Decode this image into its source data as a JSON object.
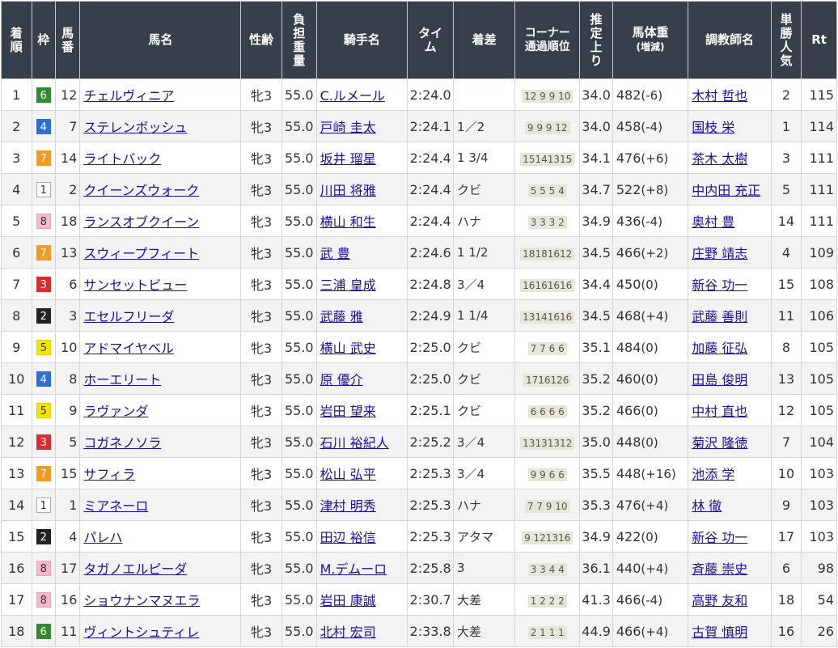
{
  "headers": {
    "rank": "着順",
    "waku": "枠",
    "umaban": "馬番",
    "name": "馬名",
    "sexage": "性齢",
    "weight": "負担重量",
    "jockey": "騎手名",
    "time": "タイム",
    "margin": "着差",
    "corner": "コーナー通過順位",
    "agari": "推定上り",
    "bodyweight": "馬体重",
    "bodyweight_sub": "(増減)",
    "trainer": "調教師名",
    "popularity": "単勝人気",
    "rt": "Rt"
  },
  "rows": [
    {
      "rank": "1",
      "waku": "6",
      "umaban": "12",
      "name": "チェルヴィニア",
      "sexage": "牝3",
      "weight": "55.0",
      "jockey": "C.ルメール",
      "time": "2:24.0",
      "margin": "",
      "corner": "12 9 9 10",
      "agari": "34.0",
      "bw": "482",
      "bwdiff": "(-6)",
      "trainer": "木村 哲也",
      "pop": "2",
      "rt": "115"
    },
    {
      "rank": "2",
      "waku": "4",
      "umaban": "7",
      "name": "ステレンボッシュ",
      "sexage": "牝3",
      "weight": "55.0",
      "jockey": "戸崎 圭太",
      "time": "2:24.1",
      "margin": "1／2",
      "corner": "9 9 9 12",
      "agari": "34.0",
      "bw": "458",
      "bwdiff": "(-4)",
      "trainer": "国枝 栄",
      "pop": "1",
      "rt": "114"
    },
    {
      "rank": "3",
      "waku": "7",
      "umaban": "14",
      "name": "ライトバック",
      "sexage": "牝3",
      "weight": "55.0",
      "jockey": "坂井 瑠星",
      "time": "2:24.4",
      "margin": "1 3/4",
      "corner": "15141315",
      "agari": "34.1",
      "bw": "476",
      "bwdiff": "(+6)",
      "trainer": "茶木 太樹",
      "pop": "3",
      "rt": "111"
    },
    {
      "rank": "4",
      "waku": "1",
      "umaban": "2",
      "name": "クイーンズウォーク",
      "sexage": "牝3",
      "weight": "55.0",
      "jockey": "川田 将雅",
      "time": "2:24.4",
      "margin": "クビ",
      "corner": "5 5 5 4",
      "agari": "34.7",
      "bw": "522",
      "bwdiff": "(+8)",
      "trainer": "中内田 充正",
      "pop": "5",
      "rt": "111"
    },
    {
      "rank": "5",
      "waku": "8",
      "umaban": "18",
      "name": "ランスオブクイーン",
      "sexage": "牝3",
      "weight": "55.0",
      "jockey": "横山 和生",
      "time": "2:24.4",
      "margin": "ハナ",
      "corner": "3 3 3 2",
      "agari": "34.9",
      "bw": "436",
      "bwdiff": "(-4)",
      "trainer": "奥村 豊",
      "pop": "14",
      "rt": "111"
    },
    {
      "rank": "6",
      "waku": "7",
      "umaban": "13",
      "name": "スウィープフィート",
      "sexage": "牝3",
      "weight": "55.0",
      "jockey": "武 豊",
      "time": "2:24.6",
      "margin": "1 1/2",
      "corner": "18181612",
      "agari": "34.5",
      "bw": "466",
      "bwdiff": "(+2)",
      "trainer": "庄野 靖志",
      "pop": "4",
      "rt": "109"
    },
    {
      "rank": "7",
      "waku": "3",
      "umaban": "6",
      "name": "サンセットビュー",
      "sexage": "牝3",
      "weight": "55.0",
      "jockey": "三浦 皇成",
      "time": "2:24.8",
      "margin": "3／4",
      "corner": "16161616",
      "agari": "34.4",
      "bw": "450",
      "bwdiff": "(0)",
      "trainer": "新谷 功一",
      "pop": "15",
      "rt": "108"
    },
    {
      "rank": "8",
      "waku": "2",
      "umaban": "3",
      "name": "エセルフリーダ",
      "sexage": "牝3",
      "weight": "55.0",
      "jockey": "武藤 雅",
      "time": "2:24.9",
      "margin": "1 1/4",
      "corner": "13141616",
      "agari": "34.5",
      "bw": "468",
      "bwdiff": "(+4)",
      "trainer": "武藤 善則",
      "pop": "11",
      "rt": "106"
    },
    {
      "rank": "9",
      "waku": "5",
      "umaban": "10",
      "name": "アドマイヤベル",
      "sexage": "牝3",
      "weight": "55.0",
      "jockey": "横山 武史",
      "time": "2:25.0",
      "margin": "クビ",
      "corner": "7 7 6 6",
      "agari": "35.1",
      "bw": "484",
      "bwdiff": "(0)",
      "trainer": "加藤 征弘",
      "pop": "8",
      "rt": "105"
    },
    {
      "rank": "10",
      "waku": "4",
      "umaban": "8",
      "name": "ホーエリート",
      "sexage": "牝3",
      "weight": "55.0",
      "jockey": "原 優介",
      "time": "2:25.0",
      "margin": "クビ",
      "corner": "1716126",
      "agari": "35.2",
      "bw": "460",
      "bwdiff": "(0)",
      "trainer": "田島 俊明",
      "pop": "13",
      "rt": "105"
    },
    {
      "rank": "11",
      "waku": "5",
      "umaban": "9",
      "name": "ラヴァンダ",
      "sexage": "牝3",
      "weight": "55.0",
      "jockey": "岩田 望来",
      "time": "2:25.1",
      "margin": "クビ",
      "corner": "6 6 6 6",
      "agari": "35.2",
      "bw": "466",
      "bwdiff": "(0)",
      "trainer": "中村 直也",
      "pop": "12",
      "rt": "105"
    },
    {
      "rank": "12",
      "waku": "3",
      "umaban": "5",
      "name": "コガネノソラ",
      "sexage": "牝3",
      "weight": "55.0",
      "jockey": "石川 裕紀人",
      "time": "2:25.2",
      "margin": "3／4",
      "corner": "13131312",
      "agari": "35.0",
      "bw": "448",
      "bwdiff": "(0)",
      "trainer": "菊沢 隆徳",
      "pop": "7",
      "rt": "104"
    },
    {
      "rank": "13",
      "waku": "7",
      "umaban": "15",
      "name": "サフィラ",
      "sexage": "牝3",
      "weight": "55.0",
      "jockey": "松山 弘平",
      "time": "2:25.3",
      "margin": "3／4",
      "corner": "9 9 6 6",
      "agari": "35.5",
      "bw": "448",
      "bwdiff": "(+16)",
      "trainer": "池添 学",
      "pop": "10",
      "rt": "103"
    },
    {
      "rank": "14",
      "waku": "1",
      "umaban": "1",
      "name": "ミアネーロ",
      "sexage": "牝3",
      "weight": "55.0",
      "jockey": "津村 明秀",
      "time": "2:25.3",
      "margin": "ハナ",
      "corner": "7 7 9 10",
      "agari": "35.3",
      "bw": "476",
      "bwdiff": "(+4)",
      "trainer": "林 徹",
      "pop": "9",
      "rt": "103"
    },
    {
      "rank": "15",
      "waku": "2",
      "umaban": "4",
      "name": "パレハ",
      "sexage": "牝3",
      "weight": "55.0",
      "jockey": "田辺 裕信",
      "time": "2:25.3",
      "margin": "アタマ",
      "corner": "9 121316",
      "agari": "34.9",
      "bw": "422",
      "bwdiff": "(0)",
      "trainer": "新谷 功一",
      "pop": "17",
      "rt": "103"
    },
    {
      "rank": "16",
      "waku": "8",
      "umaban": "17",
      "name": "タガノエルピーダ",
      "sexage": "牝3",
      "weight": "55.0",
      "jockey": "M.デムーロ",
      "time": "2:25.8",
      "margin": "3",
      "corner": "3 3 4 4",
      "agari": "36.1",
      "bw": "440",
      "bwdiff": "(+4)",
      "trainer": "斉藤 崇史",
      "pop": "6",
      "rt": "98"
    },
    {
      "rank": "17",
      "waku": "8",
      "umaban": "16",
      "name": "ショウナンマヌエラ",
      "sexage": "牝3",
      "weight": "55.0",
      "jockey": "岩田 康誠",
      "time": "2:30.7",
      "margin": "大差",
      "corner": "1 2 2 2",
      "agari": "41.3",
      "bw": "466",
      "bwdiff": "(-4)",
      "trainer": "高野 友和",
      "pop": "18",
      "rt": "54"
    },
    {
      "rank": "18",
      "waku": "6",
      "umaban": "11",
      "name": "ヴィントシュティレ",
      "sexage": "牝3",
      "weight": "55.0",
      "jockey": "北村 宏司",
      "time": "2:33.8",
      "margin": "大差",
      "corner": "2 1 1 1",
      "agari": "44.9",
      "bw": "466",
      "bwdiff": "(+4)",
      "trainer": "古賀 慎明",
      "pop": "16",
      "rt": "26"
    }
  ]
}
